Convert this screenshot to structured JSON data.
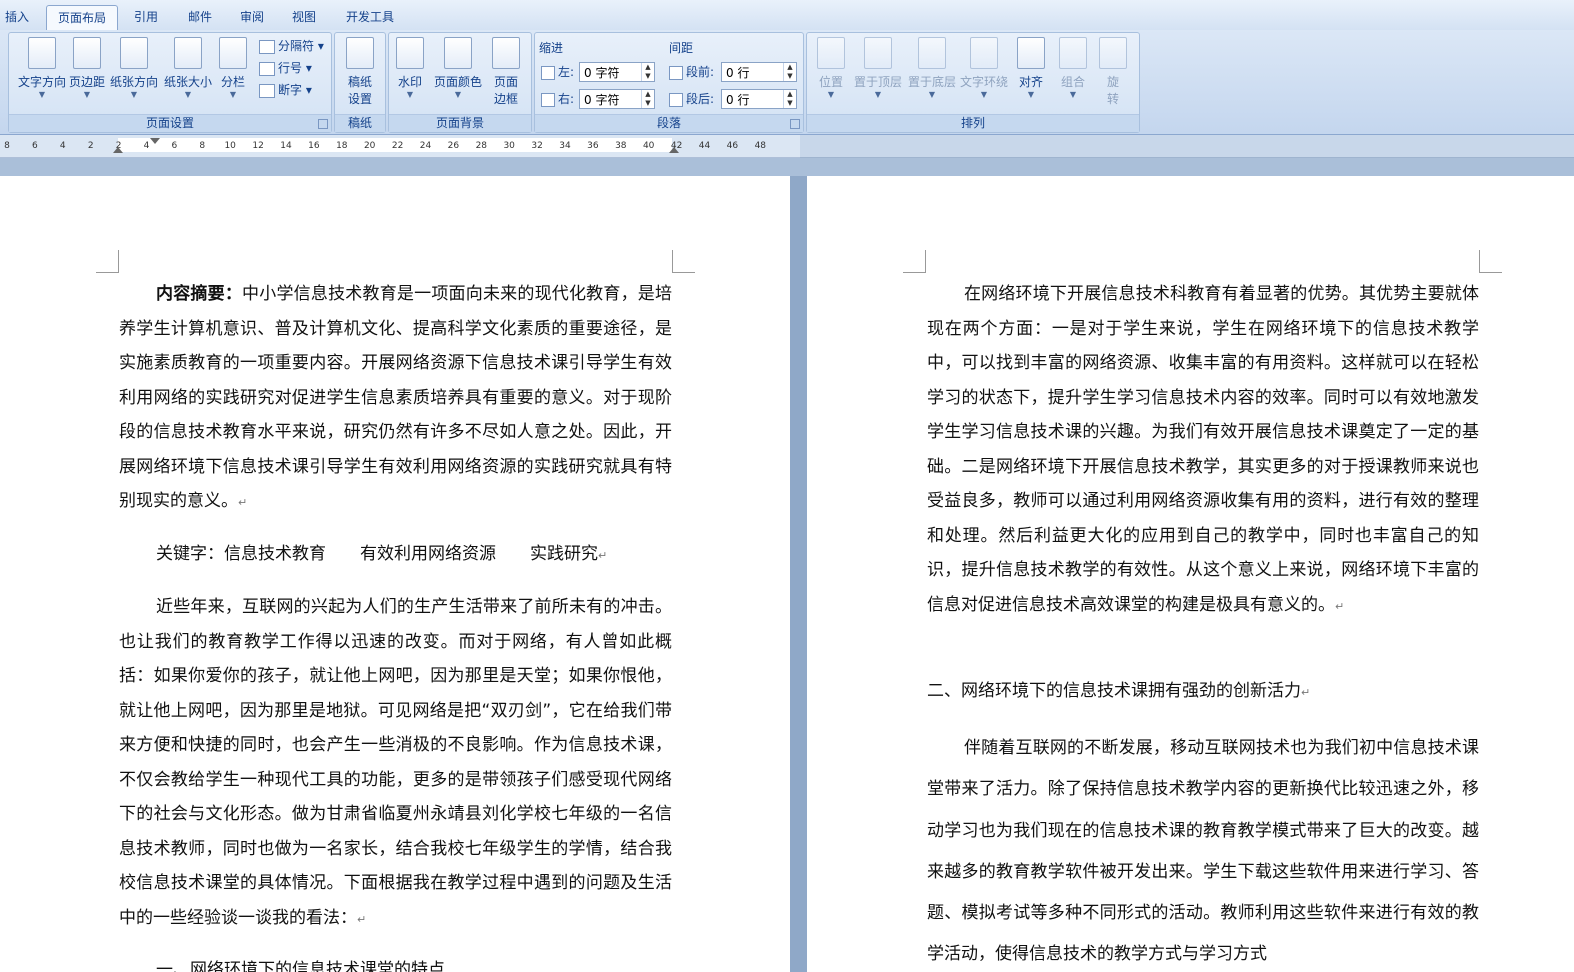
{
  "tabs": [
    "插入",
    "页面布局",
    "引用",
    "邮件",
    "审阅",
    "视图",
    "开发工具"
  ],
  "active_tab": "页面布局",
  "ribbon": {
    "page_setup": {
      "label": "页面设置",
      "text_direction": "文字方向",
      "margins": "页边距",
      "orientation": "纸张方向",
      "size": "纸张大小",
      "columns": "分栏",
      "breaks": "分隔符",
      "line_numbers": "行号",
      "hyphenation": "断字"
    },
    "draft_paper": {
      "label": "稿纸",
      "button_line1": "稿纸",
      "button_line2": "设置"
    },
    "page_background": {
      "label": "页面背景",
      "watermark": "水印",
      "page_color": "页面颜色",
      "page_borders_line1": "页面",
      "page_borders_line2": "边框"
    },
    "paragraph": {
      "label": "段落",
      "indent_title": "缩进",
      "spacing_title": "间距",
      "indent_left_label": "左:",
      "indent_left_value": "0 字符",
      "indent_right_label": "右:",
      "indent_right_value": "0 字符",
      "spacing_before_label": "段前:",
      "spacing_before_value": "0 行",
      "spacing_after_label": "段后:",
      "spacing_after_value": "0 行"
    },
    "arrange": {
      "label": "排列",
      "position": "位置",
      "bring_front": "置于顶层",
      "send_back": "置于底层",
      "text_wrap": "文字环绕",
      "align": "对齐",
      "group": "组合",
      "rotate_line1": "旋",
      "rotate_line2": "转"
    }
  },
  "ruler_ticks": [
    "8",
    "6",
    "4",
    "2",
    "2",
    "4",
    "6",
    "8",
    "10",
    "12",
    "14",
    "16",
    "18",
    "20",
    "22",
    "24",
    "26",
    "28",
    "30",
    "32",
    "34",
    "36",
    "38",
    "40",
    "42",
    "44",
    "46",
    "48"
  ],
  "left_page": {
    "abstract_label": "内容摘要：",
    "abstract_text": "中小学信息技术教育是一项面向未来的现代化教育，是培养学生计算机意识、普及计算机文化、提高科学文化素质的重要途径，是实施素质教育的一项重要内容。开展网络资源下信息技术课引导学生有效利用网络的实践研究对促进学生信息素质培养具有重要的意义。对于现阶段的信息技术教育水平来说，研究仍然有许多不尽如人意之处。因此，开展网络环境下信息技术课引导学生有效利用网络资源的实践研究就具有特别现实的意义。",
    "keywords": "关键字：信息技术教育　　有效利用网络资源　　实践研究",
    "body_text": "近些年来，互联网的兴起为人们的生产生活带来了前所未有的冲击。也让我们的教育教学工作得以迅速的改变。而对于网络，有人曾如此概括：如果你爱你的孩子，就让他上网吧，因为那里是天堂；如果你恨他，就让他上网吧，因为那里是地狱。可见网络是把“双刃剑”，它在给我们带来方便和快捷的同时，也会产生一些消极的不良影响。作为信息技术课，不仅会教给学生一种现代工具的功能，更多的是带领孩子们感受现代网络下的社会与文化形态。做为甘肃省临夏州永靖县刘化学校七年级的一名信息技术教师，同时也做为一名家长，结合我校七年级学生的学情，结合我校信息技术课堂的具体情况。下面根据我在教学过程中遇到的问题及生活中的一些经验谈一谈我的看法：",
    "partial_heading": "一、网络环境下的信息技术课堂的特点"
  },
  "right_page": {
    "para1": "在网络环境下开展信息技术科教育有着显著的优势。其优势主要就体现在两个方面：一是对于学生来说，学生在网络环境下的信息技术教学中，可以找到丰富的网络资源、收集丰富的有用资料。这样就可以在轻松学习的状态下，提升学生学习信息技术内容的效率。同时可以有效地激发学生学习信息技术课的兴趣。为我们有效开展信息技术课奠定了一定的基础。二是网络环境下开展信息技术教学，其实更多的对于授课教师来说也受益良多，教师可以通过利用网络资源收集有用的资料，进行有效的整理和处理。然后利益更大化的应用到自己的教学中，同时也丰富自己的知识，提升信息技术教学的有效性。从这个意义上来说，网络环境下丰富的信息对促进信息技术高效课堂的构建是极具有意义的。",
    "heading2": "二、网络环境下的信息技术课拥有强劲的创新活力",
    "para2": "伴随着互联网的不断发展，移动互联网技术也为我们初中信息技术课堂带来了活力。除了保持信息技术教学内容的更新换代比较迅速之外，移动学习也为我们现在的信息技术课的教育教学模式带来了巨大的改变。越来越多的教育教学软件被开发出来。学生下载这些软件用来进行学习、答题、模拟考试等多种不同形式的活动。教师利用这些软件来进行有效的教学活动，使得信息技术的教学方式与学习方式"
  }
}
